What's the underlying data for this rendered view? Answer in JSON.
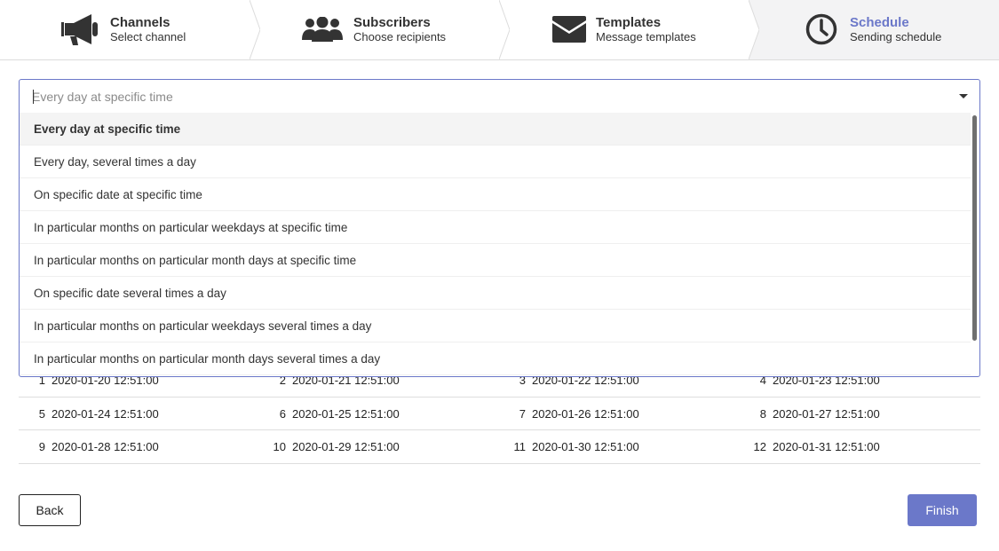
{
  "steps": [
    {
      "title": "Channels",
      "subtitle": "Select channel",
      "icon": "megaphone-icon"
    },
    {
      "title": "Subscribers",
      "subtitle": "Choose recipients",
      "icon": "users-icon"
    },
    {
      "title": "Templates",
      "subtitle": "Message templates",
      "icon": "envelope-icon"
    },
    {
      "title": "Schedule",
      "subtitle": "Sending schedule",
      "icon": "clock-icon",
      "active": true
    }
  ],
  "schedule_select": {
    "placeholder": "Every day at specific time",
    "options": [
      "Every day at specific time",
      "Every day, several times a day",
      "On specific date at specific time",
      "In particular months on particular weekdays at specific time",
      "In particular months on particular month days at specific time",
      "On specific date several times a day",
      "In particular months on particular weekdays several times a day",
      "In particular months on particular month days several times a day"
    ],
    "selected_index": 0
  },
  "schedule_preview": [
    [
      {
        "n": "1",
        "t": "2020-01-20 12:51:00"
      },
      {
        "n": "2",
        "t": "2020-01-21 12:51:00"
      },
      {
        "n": "3",
        "t": "2020-01-22 12:51:00"
      },
      {
        "n": "4",
        "t": "2020-01-23 12:51:00"
      }
    ],
    [
      {
        "n": "5",
        "t": "2020-01-24 12:51:00"
      },
      {
        "n": "6",
        "t": "2020-01-25 12:51:00"
      },
      {
        "n": "7",
        "t": "2020-01-26 12:51:00"
      },
      {
        "n": "8",
        "t": "2020-01-27 12:51:00"
      }
    ],
    [
      {
        "n": "9",
        "t": "2020-01-28 12:51:00"
      },
      {
        "n": "10",
        "t": "2020-01-29 12:51:00"
      },
      {
        "n": "11",
        "t": "2020-01-30 12:51:00"
      },
      {
        "n": "12",
        "t": "2020-01-31 12:51:00"
      }
    ]
  ],
  "buttons": {
    "back": "Back",
    "finish": "Finish"
  },
  "colors": {
    "accent": "#6b78c9",
    "active_step_bg": "#f3f3f4"
  }
}
